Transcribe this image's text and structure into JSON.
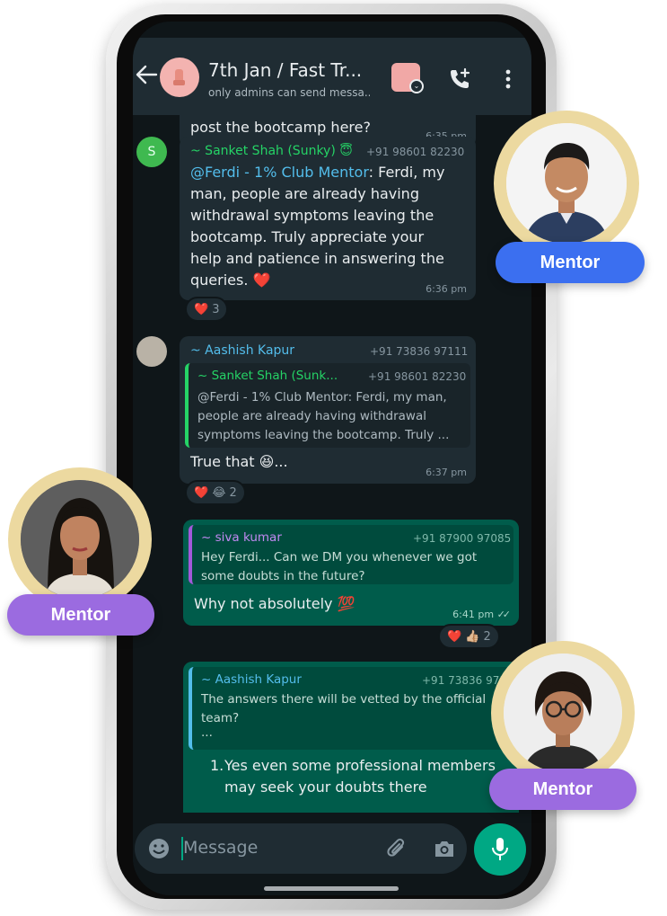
{
  "header": {
    "title": "7th Jan / Fast Tr...",
    "subtitle": "only admins can send messa..."
  },
  "messages": {
    "m0": {
      "text": "post the bootcamp here?",
      "time": "6:35 pm"
    },
    "m1": {
      "avatar_letter": "S",
      "sender": "~ Sanket Shah (Sunky) 😇",
      "phone": "+91 98601 82230",
      "mention": "@Ferdi - 1% Club Mentor",
      "text_lines": [
        ": Ferdi, my",
        "man, people are already having",
        "withdrawal symptoms leaving the",
        "bootcamp. Truly appreciate your",
        "help and patience in answering the",
        "queries. ❤️"
      ],
      "time": "6:36 pm",
      "reactions": "❤️",
      "reaction_count": "3"
    },
    "m2": {
      "sender": "~ Aashish Kapur",
      "phone": "+91 73836 97111",
      "quote_sender": "~ Sanket Shah (Sunk...",
      "quote_phone": "+91 98601 82230",
      "quote_lines": [
        "@Ferdi - 1% Club Mentor: Ferdi, my man,",
        "people are already having withdrawal",
        "symptoms leaving the bootcamp. Truly ..."
      ],
      "text": "True that 😆...",
      "time": "6:37 pm",
      "reactions": "❤️ 😂",
      "reaction_count": "2"
    },
    "m3": {
      "quote_sender": "~ siva kumar",
      "quote_phone": "+91 87900 97085",
      "quote_lines": [
        "Hey Ferdi... Can we DM you whenever we got",
        "some doubts in the future?"
      ],
      "text": "Why not absolutely 💯",
      "time": "6:41 pm",
      "ticks": "✓✓",
      "reactions": "❤️ 👍🏼",
      "reaction_count": "2"
    },
    "m4": {
      "quote_sender": "~ Aashish Kapur",
      "quote_phone": "+91 73836 9711",
      "quote_lines": [
        "The answers there will be vetted by the official",
        "team?",
        "..."
      ],
      "list_number": "1.",
      "text_lines": [
        "Yes even some professional members",
        "may seek your doubts there"
      ]
    }
  },
  "composer": {
    "placeholder": "Message"
  },
  "mentors": {
    "label": "Mentor"
  },
  "colors": {
    "accent_green": "#00a884",
    "outgoing_bubble": "#005c4b",
    "incoming_bubble": "#1f2c33",
    "mentor_blue": "#3b6ff0",
    "mentor_purple": "#9b6be0"
  }
}
